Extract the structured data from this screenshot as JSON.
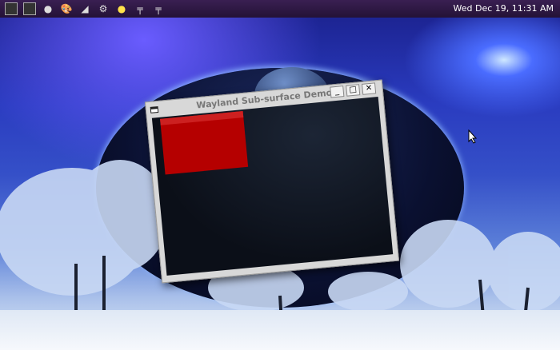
{
  "panel": {
    "launchers": [
      {
        "icon": "terminal-icon"
      },
      {
        "icon": "terminal-icon"
      },
      {
        "icon": "flower-icon"
      },
      {
        "icon": "paint-palette-icon"
      },
      {
        "icon": "smoke-icon"
      },
      {
        "icon": "gear-icon"
      },
      {
        "icon": "sun-icon"
      },
      {
        "icon": "resize-icon"
      },
      {
        "icon": "resize-icon"
      }
    ],
    "clock": "Wed Dec 19, 11:31 AM"
  },
  "window": {
    "title": "Wayland Sub-surface Demo",
    "minimize": "_",
    "maximize": "□",
    "close": "✕"
  },
  "colors": {
    "subsurface": "#b50000"
  }
}
